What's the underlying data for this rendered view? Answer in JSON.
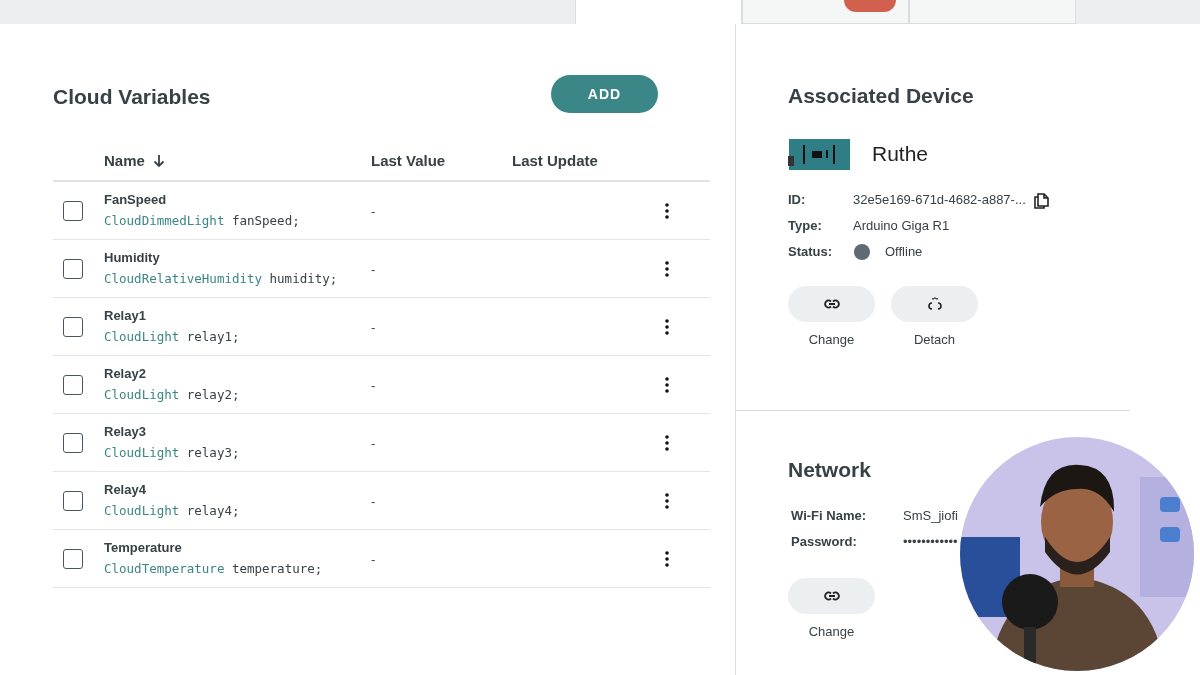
{
  "tabs": [
    {
      "selected": true,
      "badge": false
    },
    {
      "selected": false,
      "badge": true
    },
    {
      "selected": false,
      "badge": false
    }
  ],
  "variables": {
    "title": "Cloud Variables",
    "add_button": "ADD",
    "columns": [
      "Name",
      "Last Value",
      "Last Update"
    ],
    "rows": [
      {
        "name": "FanSpeed",
        "type": "CloudDimmedLight",
        "decl": "fanSpeed;",
        "last_value": "-",
        "checked": false
      },
      {
        "name": "Humidity",
        "type": "CloudRelativeHumidity",
        "decl": "humidity;",
        "last_value": "-",
        "checked": false
      },
      {
        "name": "Relay1",
        "type": "CloudLight",
        "decl": "relay1;",
        "last_value": "-",
        "checked": false
      },
      {
        "name": "Relay2",
        "type": "CloudLight",
        "decl": "relay2;",
        "last_value": "-",
        "checked": false
      },
      {
        "name": "Relay3",
        "type": "CloudLight",
        "decl": "relay3;",
        "last_value": "-",
        "checked": false
      },
      {
        "name": "Relay4",
        "type": "CloudLight",
        "decl": "relay4;",
        "last_value": "-",
        "checked": false
      },
      {
        "name": "Temperature",
        "type": "CloudTemperature",
        "decl": "temperature;",
        "last_value": "-",
        "checked": false
      }
    ]
  },
  "device": {
    "title": "Associated Device",
    "name": "Ruthe",
    "fields": [
      {
        "label": "ID:",
        "value": "32e5e169-671d-4682-a887-...",
        "kind": "copy"
      },
      {
        "label": "Type:",
        "value": "Arduino Giga R1",
        "kind": "text"
      },
      {
        "label": "Status:",
        "value": "Offline",
        "kind": "status",
        "color": "#5f6a72"
      }
    ],
    "actions": [
      {
        "label": "Change",
        "kind": "link"
      },
      {
        "label": "Detach",
        "kind": "unlink"
      }
    ]
  },
  "network": {
    "title": "Network",
    "fields": [
      {
        "label": "Wi-Fi Name:",
        "value": "SmS_jiofi"
      },
      {
        "label": "Password:",
        "value": "••••••••••••"
      }
    ],
    "actions": [
      {
        "label": "Change",
        "kind": "link"
      }
    ]
  }
}
